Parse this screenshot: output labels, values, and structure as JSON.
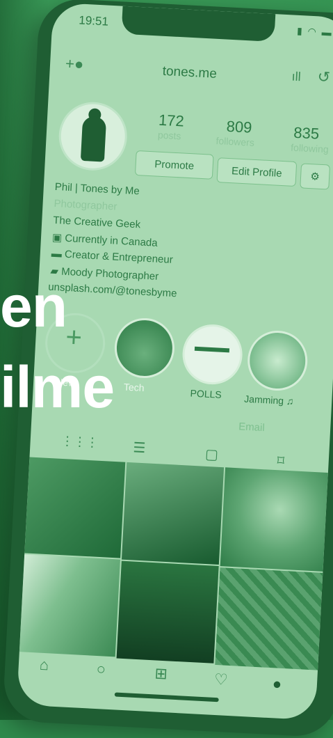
{
  "status_bar": {
    "time": "19:51"
  },
  "profile": {
    "username": "tones.me",
    "stats": [
      {
        "value": "172",
        "label": "posts"
      },
      {
        "value": "809",
        "label": "followers"
      },
      {
        "value": "835",
        "label": "following"
      }
    ],
    "promote_label": "Promote",
    "edit_profile_label": "Edit Profile",
    "name": "Phil | Tones by Me",
    "category": "Photographer",
    "bio_lines": [
      "The Creative Geek",
      "Currently in Canada",
      "Creator & Entrepreneur",
      "Moody Photographer",
      "unsplash.com/@tonesbyme"
    ],
    "email_label": "Email"
  },
  "highlights": [
    {
      "label": "New"
    },
    {
      "label": "Tech"
    },
    {
      "label": "POLLS"
    },
    {
      "label": "Jamming"
    }
  ],
  "overlay_headline": {
    "line1": "en",
    "line2": "ilme"
  },
  "colors": {
    "overlay_green": "#2f8a4c",
    "headline": "#ffffff"
  }
}
